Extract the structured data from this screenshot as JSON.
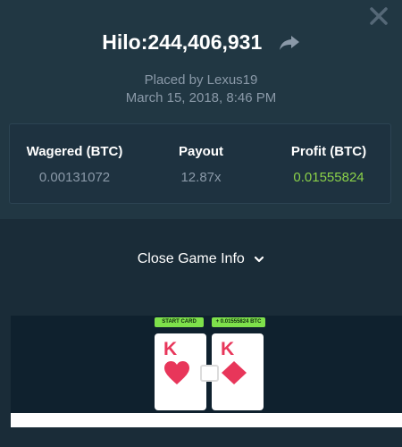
{
  "header": {
    "title": "Hilo:244,406,931",
    "placed_by": "Placed by Lexus19",
    "date": "March 15, 2018, 8:46 PM"
  },
  "stats": {
    "wagered_label": "Wagered (BTC)",
    "wagered_value": "0.00131072",
    "payout_label": "Payout",
    "payout_value": "12.87x",
    "profit_label": "Profit (BTC)",
    "profit_value": "0.01555824"
  },
  "toggle": {
    "close_info_label": "Close Game Info"
  },
  "game": {
    "start_tag": "START CARD",
    "win_tag": "+ 0.01555824 BTC",
    "cards": [
      {
        "rank": "K",
        "suit": "hearts"
      },
      {
        "rank": "K",
        "suit": "diamonds"
      }
    ]
  },
  "colors": {
    "profit": "#8bd149",
    "card_red": "#e8365a",
    "tag_green": "#7ee04b"
  },
  "icons": [
    "close-icon",
    "share-icon",
    "chevron-down-icon",
    "heart-icon",
    "diamond-icon"
  ]
}
